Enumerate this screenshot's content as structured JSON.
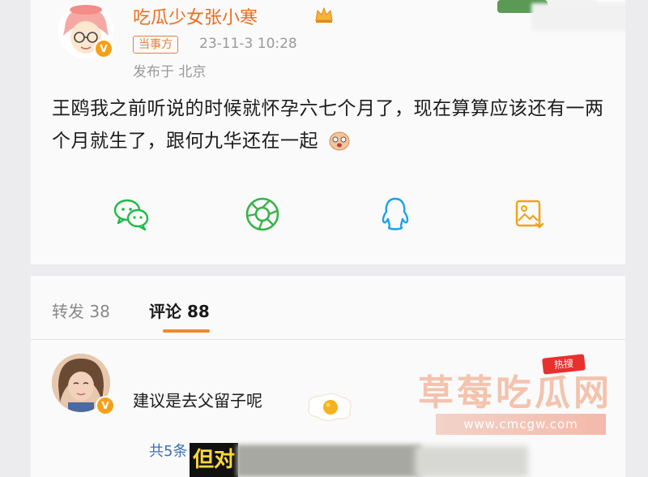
{
  "post": {
    "username": "吃瓜少女张小寒",
    "tag": "当事方",
    "timestamp": "23-11-3 10:28",
    "location": "发布于 北京",
    "text": "王鸥我之前听说的时候就怀孕六七个月了，现在算算应该还有一两个月就生了，跟何九华还在一起"
  },
  "share": {
    "icons": [
      "wechat-icon",
      "moments-icon",
      "qq-icon",
      "save-image-icon"
    ]
  },
  "tabs": {
    "repost": "转发 38",
    "comment": "评论 88"
  },
  "comment": {
    "text": "建议是去父留子呢",
    "replies": "共5条"
  },
  "overlay": {
    "badge_text": "热搜",
    "watermark_title": "草莓吃瓜网",
    "watermark_url": "www.cmcgw.com",
    "subtitle": "但对"
  },
  "colors": {
    "accent": "#f08a2b",
    "username": "#ee6d1c",
    "vip_badge": "#f6a01a",
    "link": "#3a6fb8"
  }
}
